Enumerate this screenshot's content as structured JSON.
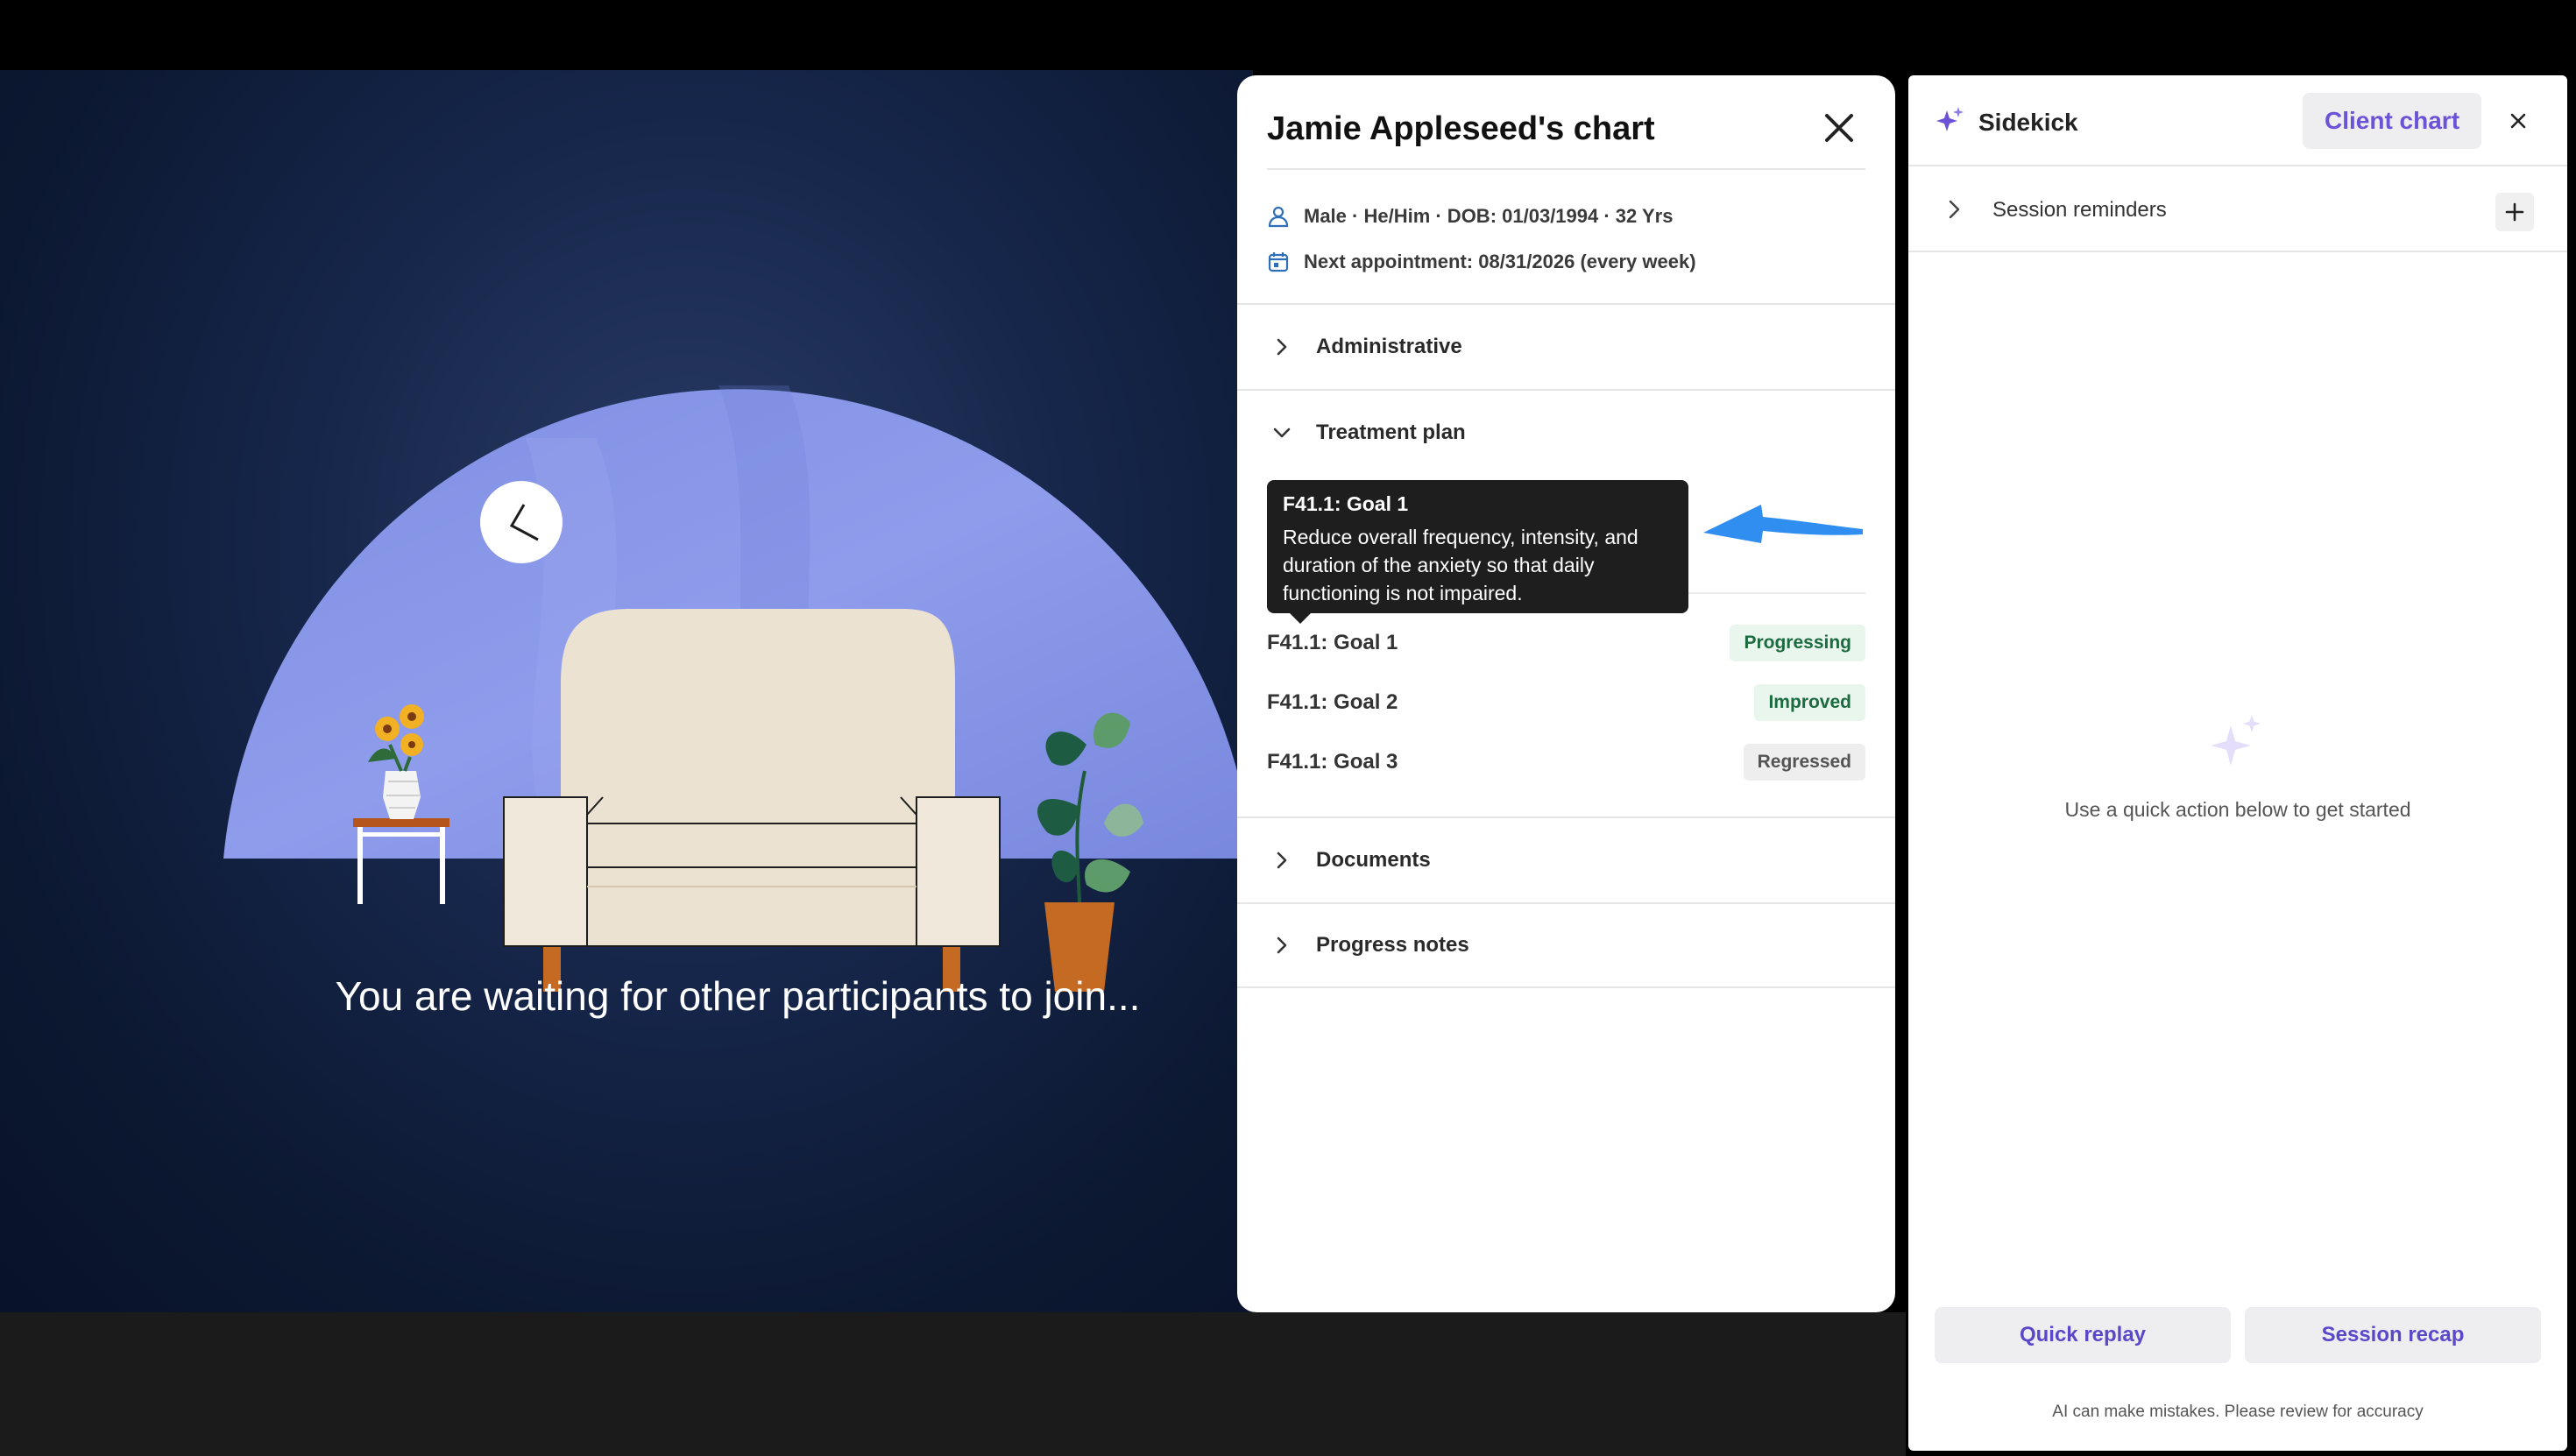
{
  "waiting_room": {
    "message": "You are waiting for other participants to join..."
  },
  "chart_panel": {
    "title": "Jamie Appleseed's chart",
    "demographics": "Male · He/Him · DOB: 01/03/1994 · 32 Yrs",
    "next_appointment": "Next appointment: 08/31/2026 (every week)",
    "sections": {
      "administrative": "Administrative",
      "treatment_plan": "Treatment plan",
      "documents": "Documents",
      "progress_notes": "Progress notes"
    },
    "tooltip": {
      "title": "F41.1: Goal 1",
      "body": "Reduce overall frequency, intensity, and duration of the anxiety so that daily functioning is not impaired."
    },
    "goals": [
      {
        "label": "F41.1: Goal 1",
        "status": "Progressing"
      },
      {
        "label": "F41.1: Goal 2",
        "status": "Improved"
      },
      {
        "label": "F41.1: Goal 3",
        "status": "Regressed"
      }
    ]
  },
  "sidekick": {
    "title": "Sidekick",
    "client_chart_button": "Client chart",
    "session_reminders": "Session reminders",
    "empty_state": "Use a quick action below to get started",
    "actions": [
      "Quick replay",
      "Session recap"
    ],
    "disclaimer": "AI can make mistakes. Please review for accuracy"
  },
  "colors": {
    "accent": "#6b52d6",
    "annotation_arrow": "#2f8ef0",
    "badge_green_bg": "#e8f6ee",
    "badge_green_text": "#1c6b3f",
    "backdrop": "#8a98e6"
  },
  "icons": [
    "person-icon",
    "calendar-icon",
    "chevron-right-icon",
    "chevron-down-icon",
    "close-icon",
    "sparkle-icon",
    "plus-icon"
  ]
}
